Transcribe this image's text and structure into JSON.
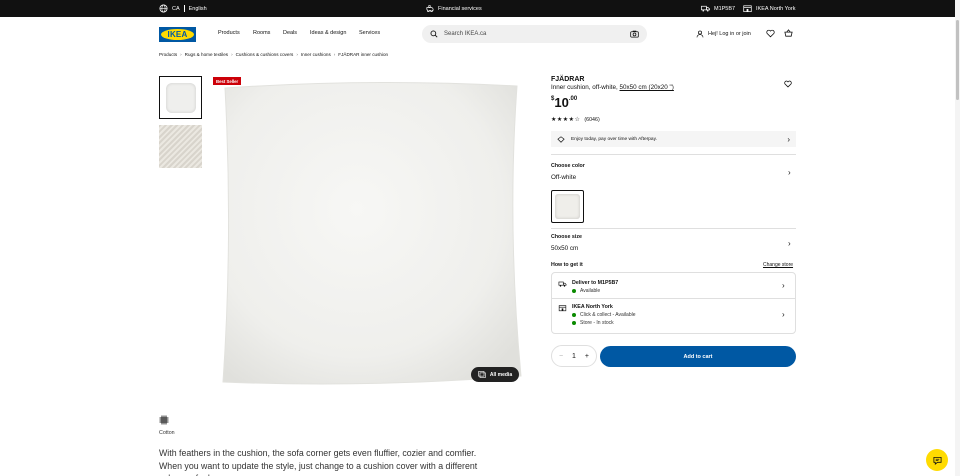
{
  "topbar": {
    "country": "CA",
    "language": "English",
    "financial": "Financial services",
    "postal": "M1P5B7",
    "store": "IKEA North York"
  },
  "header": {
    "logo": "IKEA",
    "nav": [
      "Products",
      "Rooms",
      "Deals",
      "Ideas & design",
      "Services"
    ],
    "search_placeholder": "Search IKEA.ca",
    "login": "Hej! Log in or join"
  },
  "breadcrumb": [
    "Products",
    "Rugs & home textiles",
    "Cushions & cushions covers",
    "Inner cushions",
    "FJÄDRAR inner cushion"
  ],
  "gallery": {
    "badge": "Best Seller",
    "all_media": "All media"
  },
  "product": {
    "name": "FJÄDRAR",
    "desc_prefix": "Inner cushion, off-white, ",
    "desc_size": "50x50 cm (20x20 \")",
    "price_currency": "$",
    "price_whole": "10",
    "price_decimal": ".00",
    "rating_value": 4.5,
    "review_count": "(6046)",
    "afterpay": "Enjoy today, pay over time with Afterpay.",
    "choose_color_label": "Choose color",
    "color_value": "Off-white",
    "choose_size_label": "Choose size",
    "size_value": "50x50 cm",
    "how_to_get": "How to get it",
    "change_store": "Change store",
    "deliver_title": "Deliver to M1P5B7",
    "deliver_status": "Available",
    "store_title": "IKEA North York",
    "store_status1": "Click & collect - Available",
    "store_status2": "Store - In stock",
    "quantity": "1",
    "add_to_cart": "Add to cart",
    "material": "Cotton",
    "blurb": "With feathers in the cushion, the sofa corner gets even fluffier, cozier and comfier. When you want to update the style, just change to a cushion cover with a different colour or feel."
  },
  "colors": {
    "brand_blue": "#0058a3",
    "brand_yellow": "#ffdb00",
    "badge_red": "#cc0008",
    "available_green": "#0a8a00"
  },
  "icons": [
    "globe-icon",
    "piggybank-icon",
    "truck-icon",
    "store-icon",
    "search-icon",
    "camera-icon",
    "user-icon",
    "heart-icon",
    "cart-icon",
    "chevron-right-icon",
    "media-icon",
    "fabric-icon",
    "chat-icon"
  ]
}
